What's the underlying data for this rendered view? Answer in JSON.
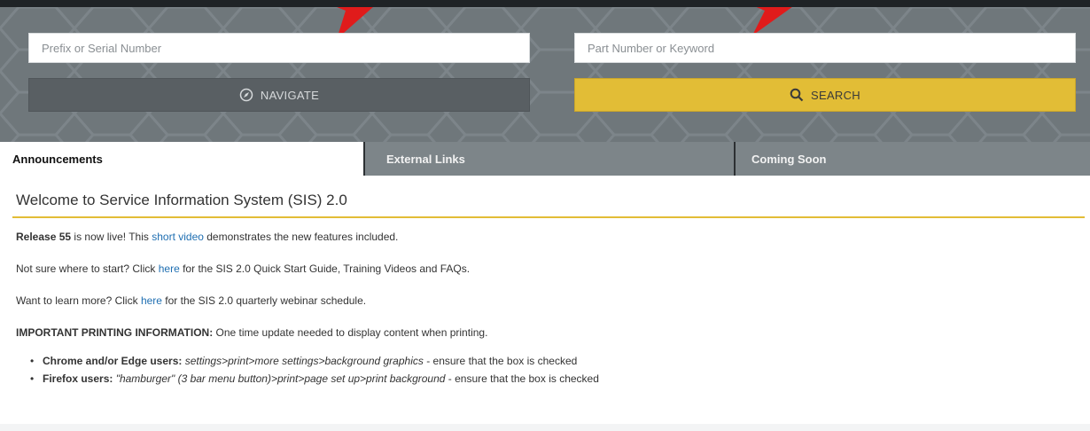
{
  "search_panel": {
    "serial_placeholder": "Prefix or Serial Number",
    "part_placeholder": "Part Number or Keyword",
    "navigate_label": "NAVIGATE",
    "search_label": "SEARCH"
  },
  "tabs": [
    {
      "label": "Announcements",
      "active": true
    },
    {
      "label": "External Links",
      "active": false
    },
    {
      "label": "Coming Soon",
      "active": false
    }
  ],
  "announcements": {
    "heading": "Welcome to Service Information System (SIS) 2.0",
    "line1": {
      "bold": "Release 55",
      "pre": " is now live! This ",
      "link": "short video",
      "post": " demonstrates the new features included."
    },
    "line2": {
      "pre": "Not sure where to start? Click ",
      "link": "here",
      "post": " for the SIS 2.0 Quick Start Guide, Training Videos and FAQs."
    },
    "line3": {
      "pre": "Want to learn more? Click ",
      "link": "here",
      "post": " for the SIS 2.0 quarterly webinar schedule."
    },
    "line4": {
      "bold": "IMPORTANT PRINTING INFORMATION:",
      "post": " One time update needed to display content when printing."
    },
    "bullets": [
      {
        "bold": "Chrome and/or Edge users:",
        "italic": " settings>print>more settings>background graphics",
        "post": " - ensure that the box is checked"
      },
      {
        "bold": "Firefox users:",
        "italic": " \"hamburger\" (3 bar menu button)>print>page set up>print background",
        "post": " - ensure that the box is checked"
      }
    ]
  },
  "colors": {
    "header_bg": "#6f777b",
    "accent_yellow": "#e2bd36",
    "callout_red": "#e01b1b",
    "link_blue": "#1f6fb2"
  },
  "icons": {
    "navigate": "compass-icon",
    "search": "search-icon"
  }
}
